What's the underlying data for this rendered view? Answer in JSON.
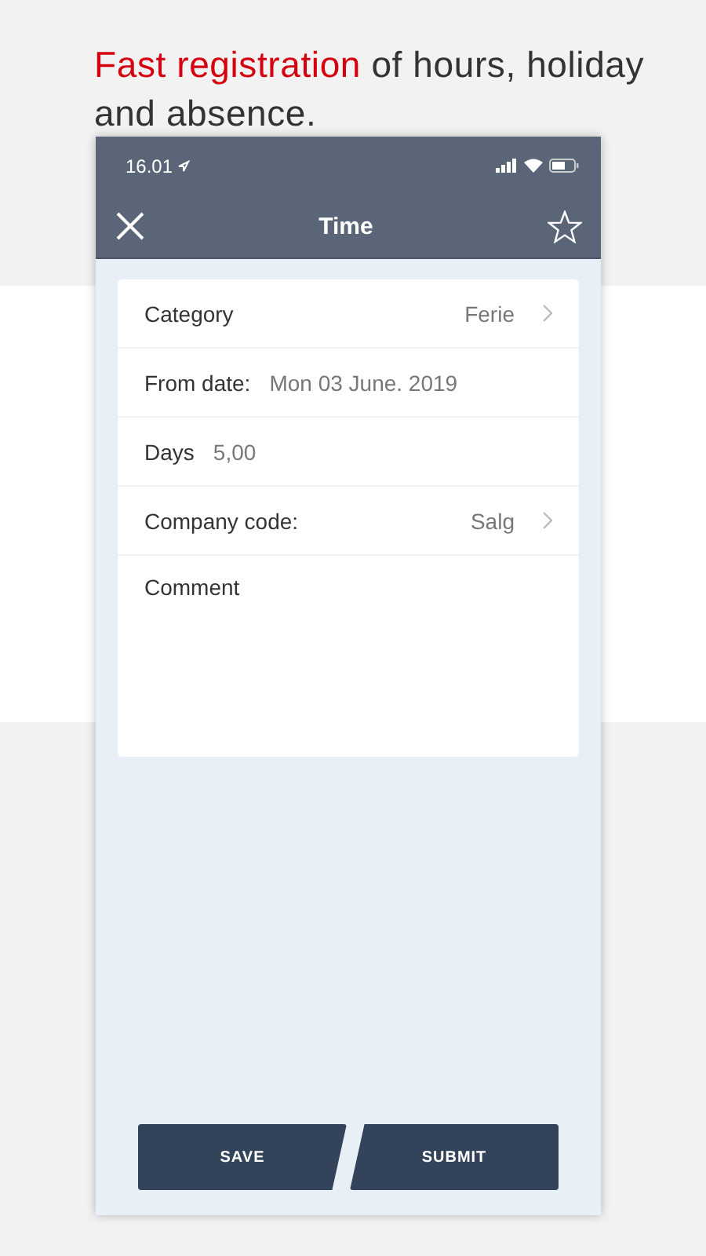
{
  "headline": {
    "highlight": "Fast registration",
    "text": "of hours, holiday and absence."
  },
  "status_bar": {
    "time": "16.01"
  },
  "nav_bar": {
    "title": "Time"
  },
  "form": [
    {
      "kind": "select",
      "label": "Category",
      "value": "Ferie"
    },
    {
      "kind": "inline",
      "label": "From date:",
      "value": "Mon 03 June. 2019"
    },
    {
      "kind": "inline",
      "label": "Days",
      "value": "5,00"
    },
    {
      "kind": "select",
      "label": "Company code:",
      "value": "Salg"
    },
    {
      "kind": "comment",
      "label": "Comment"
    }
  ],
  "buttons": [
    "SAVE",
    "SUBMIT"
  ]
}
